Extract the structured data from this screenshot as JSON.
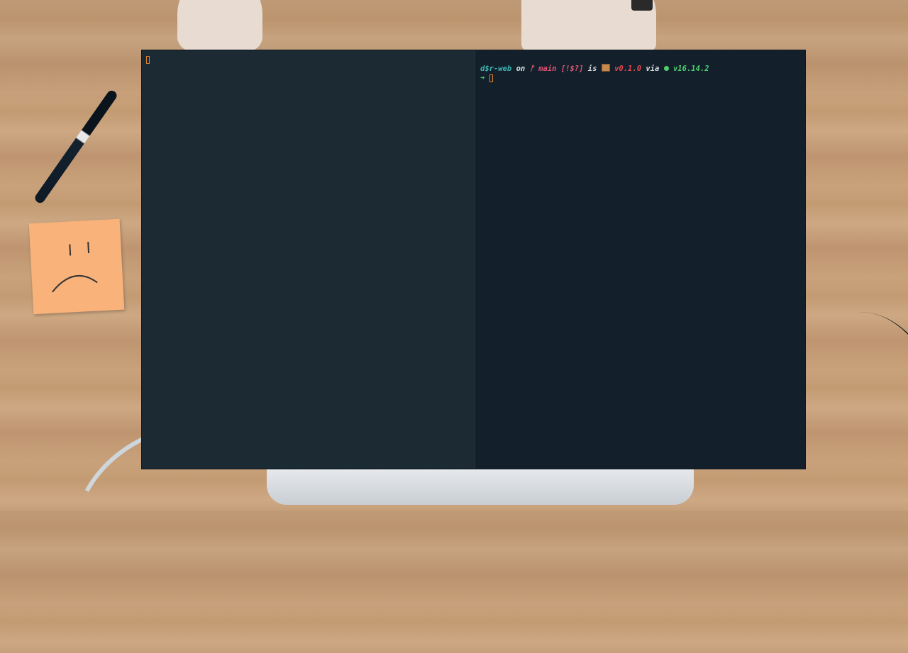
{
  "terminal": {
    "prompt": {
      "directory": "d$r-web",
      "on_word": "on",
      "branch_symbol": "ᚠ",
      "branch": "main",
      "git_status": "[!$?]",
      "is_word": "is",
      "package_icon": "package-icon",
      "package_version": "v0.1.0",
      "via_word": "via",
      "node_icon": "nodejs-icon",
      "node_version": "v16.14.2",
      "arrow": "➜"
    }
  },
  "colors": {
    "left_pane_bg": "#1b2a33",
    "right_pane_bg": "#13202b",
    "directory": "#3fb6b3",
    "git": "#e05472",
    "package": "#e0474d",
    "node": "#4fcf6d",
    "cursor": "#d9822b"
  }
}
